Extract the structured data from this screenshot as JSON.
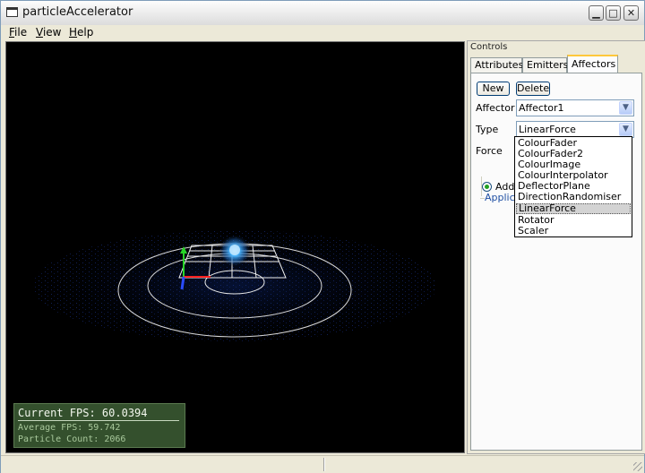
{
  "window": {
    "title": "particleAccelerator"
  },
  "title_buttons": {
    "minimize": "▁",
    "maximize": "□",
    "close": "✕"
  },
  "menu": [
    {
      "key": "F",
      "rest": "ile"
    },
    {
      "key": "V",
      "rest": "iew"
    },
    {
      "key": "H",
      "rest": "elp"
    }
  ],
  "stats": {
    "current": "Current  FPS:  60.0394",
    "average": "Average  FPS:  59.742",
    "particles": "Particle  Count:  2066"
  },
  "panel": {
    "title": "Controls",
    "tabs": [
      "Attributes",
      "Emitters",
      "Affectors"
    ],
    "active_tab": "Affectors",
    "new_button": "New",
    "delete_button": "Delete",
    "affector_label": "Affector",
    "affector_value": "Affector1",
    "type_label": "Type",
    "type_value": "LinearForce",
    "force_label": "Force",
    "group_label": "Applicat",
    "radio_label": "Add",
    "dropdown_arrow": "▼",
    "type_options": [
      "ColourFader",
      "ColourFader2",
      "ColourImage",
      "ColourInterpolator",
      "DeflectorPlane",
      "DirectionRandomiser",
      "LinearForce",
      "Rotator",
      "Scaler"
    ],
    "selected_option": "LinearForce"
  },
  "colors": {
    "stats_bg": "#34502d",
    "particle_glow": "#49b6ff",
    "axis_x": "#ff2020",
    "axis_y": "#28d428",
    "axis_z": "#2a4cff",
    "tab_highlight": "#ffc83c"
  }
}
